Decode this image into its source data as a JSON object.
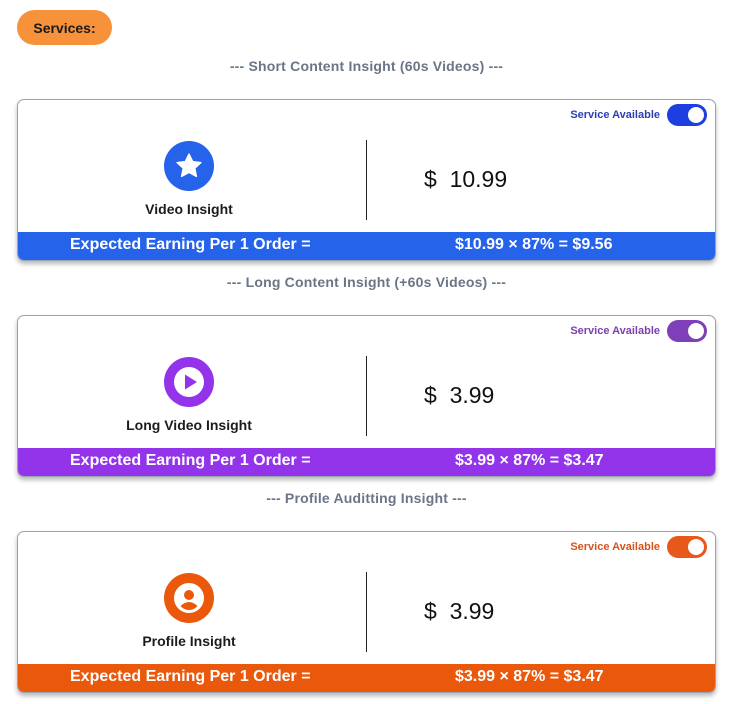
{
  "header": {
    "services_label": "Services:"
  },
  "sections": [
    {
      "heading": "--- Short Content Insight (60s Videos) ---",
      "availability_label": "Service Available",
      "service_name": "Video Insight",
      "icon": "star-icon",
      "price": "$  10.99",
      "earning_label": "Expected Earning Per 1 Order =",
      "earning_calc": "$10.99 × 87% = $9.56",
      "color": "#2563eb"
    },
    {
      "heading": "--- Long Content Insight (+60s Videos) ---",
      "availability_label": "Service Available",
      "service_name": "Long Video Insight",
      "icon": "play-icon",
      "price": "$  3.99",
      "earning_label": "Expected Earning Per 1 Order =",
      "earning_calc": "$3.99 × 87% = $3.47",
      "color": "#9333ea"
    },
    {
      "heading": "--- Profile Auditting Insight ---",
      "availability_label": "Service Available",
      "service_name": "Profile Insight",
      "icon": "user-icon",
      "price": "$  3.99",
      "earning_label": "Expected Earning Per 1 Order =",
      "earning_calc": "$3.99 × 87% = $3.47",
      "color": "#ea580c"
    }
  ],
  "toggle_colors": [
    "#1d3fe0",
    "#7e3fb8",
    "#e8581a"
  ],
  "label_colors": [
    "#2d3fb0",
    "#7b3fb0",
    "#d4541a"
  ]
}
